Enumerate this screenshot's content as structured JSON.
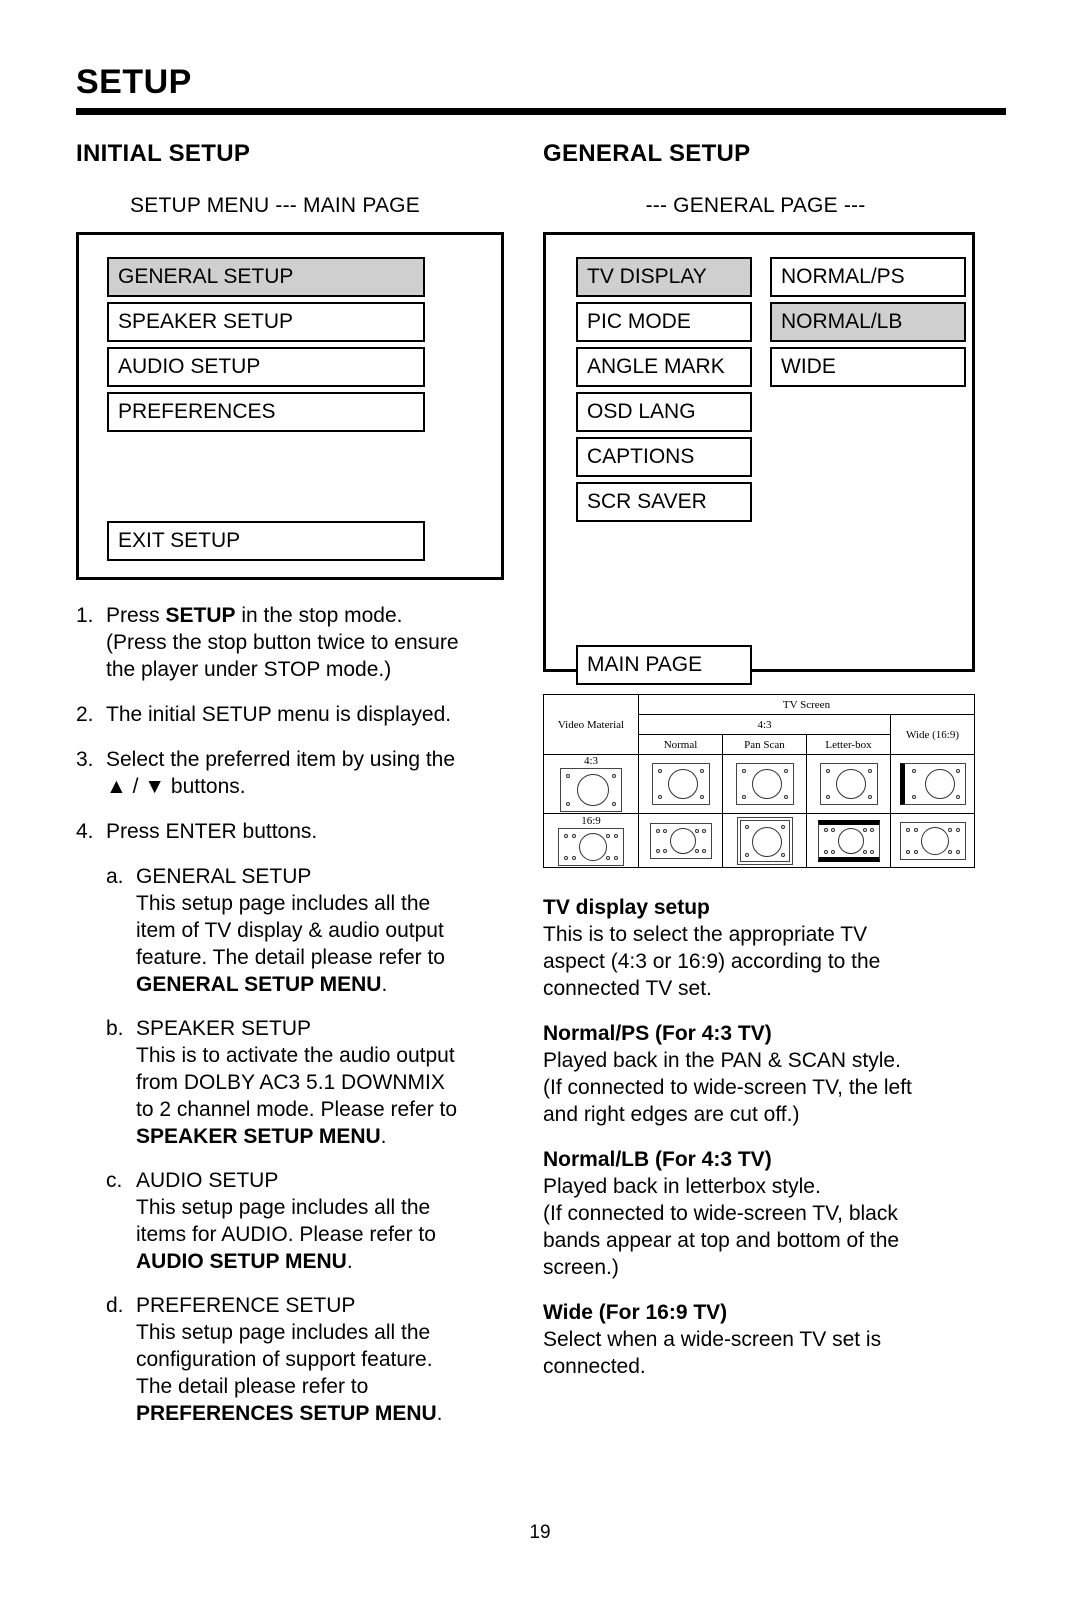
{
  "header": {
    "title": "SETUP"
  },
  "page_number": "19",
  "left": {
    "section_title": "INITIAL SETUP",
    "subtitle": "SETUP MENU --- MAIN PAGE",
    "osd_menu": {
      "items": [
        {
          "label": "GENERAL SETUP",
          "selected": true
        },
        {
          "label": "SPEAKER SETUP",
          "selected": false
        },
        {
          "label": "AUDIO SETUP",
          "selected": false
        },
        {
          "label": "PREFERENCES",
          "selected": false
        }
      ],
      "exit_label": "EXIT SETUP"
    },
    "steps": [
      {
        "num": "1.",
        "lines": [
          "Press SETUP in the stop mode.",
          "(Press the stop button twice to ensure",
          "the player under STOP mode.)"
        ],
        "bold_word": "SETUP"
      },
      {
        "num": "2.",
        "lines": [
          "The initial SETUP menu is displayed."
        ]
      },
      {
        "num": "3.",
        "lines": [
          "Select the preferred item by using the",
          "▲ / ▼ buttons."
        ]
      },
      {
        "num": "4.",
        "lines": [
          "Press ENTER buttons."
        ]
      }
    ],
    "sublist": [
      {
        "letter": "a.",
        "heading": "GENERAL SETUP",
        "lines": [
          "This setup page includes all the",
          "item of TV display & audio output",
          "feature.  The detail please refer to"
        ],
        "bold_ref": "GENERAL SETUP MENU",
        "bold_ref_suffix": "."
      },
      {
        "letter": "b.",
        "heading": "SPEAKER SETUP",
        "lines": [
          "This is to activate the audio output",
          "from DOLBY AC3 5.1 DOWNMIX",
          "to 2 channel mode.  Please refer to"
        ],
        "bold_ref": "SPEAKER SETUP MENU",
        "bold_ref_suffix": "."
      },
      {
        "letter": "c.",
        "heading": "AUDIO SETUP",
        "lines": [
          "This setup page includes all the",
          "items for AUDIO.  Please refer to"
        ],
        "bold_ref": "AUDIO SETUP MENU",
        "bold_ref_suffix": "."
      },
      {
        "letter": "d.",
        "heading": "PREFERENCE SETUP",
        "lines": [
          "This setup page includes all the",
          "configuration of support feature.",
          "The detail please refer to"
        ],
        "bold_ref": "PREFERENCES SETUP MENU",
        "bold_ref_suffix": "."
      }
    ]
  },
  "right": {
    "section_title": "GENERAL SETUP",
    "subtitle": "--- GENERAL PAGE ---",
    "osd_menu": {
      "items": [
        {
          "label": "TV DISPLAY",
          "selected": true
        },
        {
          "label": "PIC MODE",
          "selected": false
        },
        {
          "label": "ANGLE MARK",
          "selected": false
        },
        {
          "label": "OSD LANG",
          "selected": false
        },
        {
          "label": "CAPTIONS",
          "selected": false
        },
        {
          "label": "SCR SAVER",
          "selected": false
        }
      ],
      "options": [
        {
          "label": "NORMAL/PS",
          "selected": false
        },
        {
          "label": "NORMAL/LB",
          "selected": true
        },
        {
          "label": "WIDE",
          "selected": false
        }
      ],
      "main_page_label": "MAIN PAGE"
    },
    "tv_table": {
      "corner_label": "Video Material",
      "tv_screen_label": "TV Screen",
      "group_43": "4:3",
      "group_wide": "Wide (16:9)",
      "sub_headers": [
        "Normal",
        "Pan Scan",
        "Letter-box"
      ],
      "row_labels": [
        "4:3",
        "16:9"
      ]
    },
    "text_blocks": [
      {
        "heading": "TV display setup",
        "lines": [
          "This is to select the appropriate TV",
          "aspect (4:3 or 16:9) according to the",
          "connected TV set."
        ]
      },
      {
        "heading": "Normal/PS (For 4:3 TV)",
        "lines": [
          "Played back in the PAN & SCAN style.",
          "(If connected to wide-screen TV, the left",
          "and right edges are cut off.)"
        ]
      },
      {
        "heading": "Normal/LB (For 4:3 TV)",
        "lines": [
          "Played back in letterbox style.",
          "(If connected to wide-screen TV, black",
          "bands appear at top and bottom of the",
          "screen.)"
        ]
      },
      {
        "heading": "Wide (For 16:9 TV)",
        "lines": [
          "Select when a wide-screen TV set is",
          "connected."
        ]
      }
    ]
  }
}
